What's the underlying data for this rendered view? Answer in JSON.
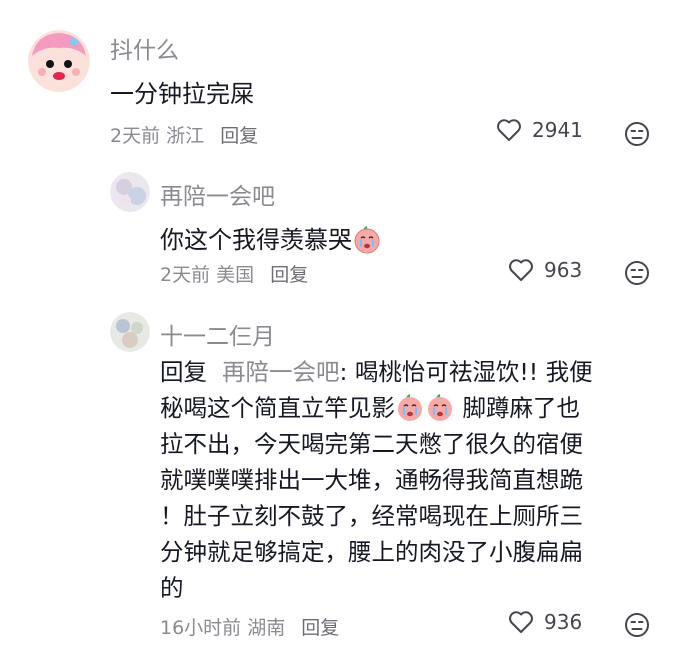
{
  "comments": [
    {
      "username": "抖什么",
      "text": "一分钟拉完屎",
      "time": "2天前",
      "location": "浙江",
      "reply_label": "回复",
      "likes": "2941"
    },
    {
      "username": "再陪一会吧",
      "text": "你这个我得羡慕哭",
      "time": "2天前",
      "location": "美国",
      "reply_label": "回复",
      "likes": "963"
    },
    {
      "username": "十一二仨月",
      "reply_prefix": "回复",
      "mention": "再陪一会吧",
      "lines": [
        ": 喝桃怡可祛湿饮!! 我便",
        "秘喝这个简直立竿见影",
        "脚蹲麻了也",
        "拉不出，今天喝完第二天憋了很久的宿便",
        "就噗噗噗排出一大堆，通畅得我简直想跪",
        "！肚子立刻不鼓了，经常喝现在上厕所三",
        "分钟就足够搞定，腰上的肉没了小腹扁扁",
        "的"
      ],
      "time": "16小时前",
      "location": "湖南",
      "reply_label": "回复",
      "likes": "936"
    }
  ],
  "icons": {
    "like": "heart-outline-icon",
    "dislike": "unamused-face-icon",
    "emoji": "crying-peach-emoji"
  }
}
